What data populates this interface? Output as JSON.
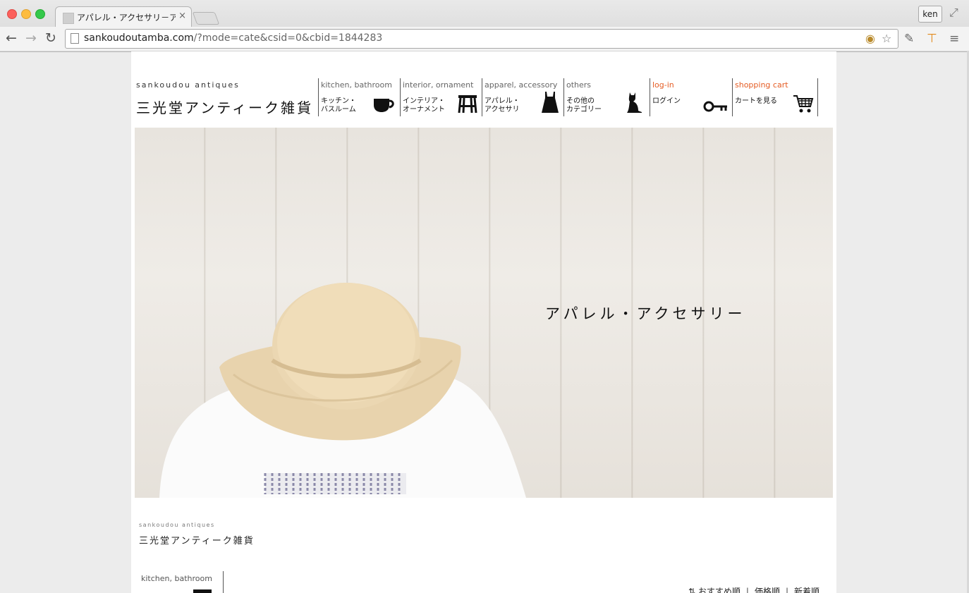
{
  "browser": {
    "tab_title": "アパレル・アクセサリ－アン",
    "tab_close": "×",
    "user": "ken",
    "url_host": "sankoudoutamba.com",
    "url_path": "/?mode=cate&csid=0&cbid=1844283",
    "icons": [
      "back-icon",
      "forward-icon",
      "reload-icon",
      "page-icon",
      "bookmark-star-icon",
      "eyedropper-icon",
      "extension-icon",
      "menu-icon"
    ]
  },
  "site": {
    "brand_en": "sankoudou antiques",
    "brand_jp": "三光堂アンティーク雑貨",
    "nav": [
      {
        "en": "kitchen, bathroom",
        "jp": "キッチン・\nバスルーム",
        "icon": "cup-icon"
      },
      {
        "en": "interior, ornament",
        "jp": "インテリア・\nオーナメント",
        "icon": "stool-icon"
      },
      {
        "en": "apparel, accessory",
        "jp": "アパレル・\nアクセサリ",
        "icon": "dress-icon"
      },
      {
        "en": "others",
        "jp": "その他の\nカテゴリー",
        "icon": "cat-icon"
      },
      {
        "en": "log-in",
        "jp": "ログイン",
        "icon": "key-icon"
      },
      {
        "en": "shopping cart",
        "jp": "カートを見る",
        "icon": "cart-icon"
      }
    ],
    "accent_color": "#e55c23",
    "hero_caption": "アパレル・アクセサリー",
    "footer_brand_en": "sankoudou antiques",
    "footer_brand_jp": "三光堂アンティーク雑貨",
    "side_category": "kitchen, bathroom",
    "sort": {
      "icon": "⇅",
      "recommended": "おすすめ順",
      "price": "価格順",
      "newest": "新着順",
      "sep": "|"
    }
  }
}
